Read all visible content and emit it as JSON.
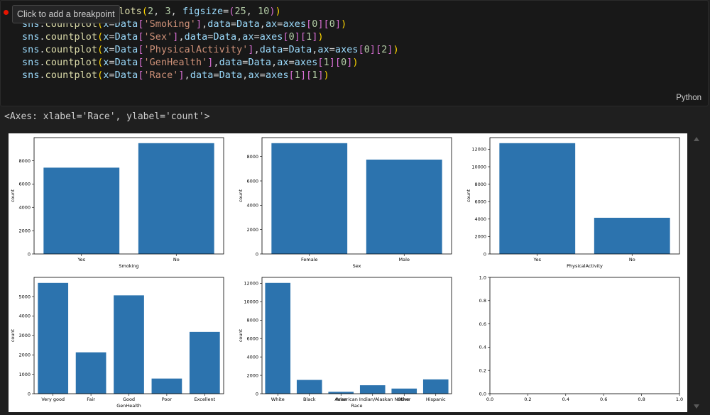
{
  "editor": {
    "tooltip": "Click to add a breakpoint",
    "language": "Python",
    "code_lines": [
      [
        {
          "t": "plots",
          "c": "tok-fn"
        },
        {
          "t": "(",
          "c": "tok-br"
        },
        {
          "t": "2",
          "c": "tok-num"
        },
        {
          "t": ", ",
          "c": "tok-op"
        },
        {
          "t": "3",
          "c": "tok-num"
        },
        {
          "t": ", ",
          "c": "tok-op"
        },
        {
          "t": "figsize",
          "c": "tok-var"
        },
        {
          "t": "=",
          "c": "tok-op"
        },
        {
          "t": "(",
          "c": "tok-br2"
        },
        {
          "t": "25",
          "c": "tok-num"
        },
        {
          "t": ", ",
          "c": "tok-op"
        },
        {
          "t": "10",
          "c": "tok-num"
        },
        {
          "t": ")",
          "c": "tok-br2"
        },
        {
          "t": ")",
          "c": "tok-br"
        }
      ],
      [
        {
          "t": "sns",
          "c": "tok-var"
        },
        {
          "t": ".",
          "c": "tok-op"
        },
        {
          "t": "countplot",
          "c": "tok-fn"
        },
        {
          "t": "(",
          "c": "tok-br"
        },
        {
          "t": "x",
          "c": "tok-var"
        },
        {
          "t": "=",
          "c": "tok-op"
        },
        {
          "t": "Data",
          "c": "tok-var"
        },
        {
          "t": "[",
          "c": "tok-br2"
        },
        {
          "t": "'Smoking'",
          "c": "tok-str"
        },
        {
          "t": "]",
          "c": "tok-br2"
        },
        {
          "t": ",",
          "c": "tok-op"
        },
        {
          "t": "data",
          "c": "tok-var"
        },
        {
          "t": "=",
          "c": "tok-op"
        },
        {
          "t": "Data",
          "c": "tok-var"
        },
        {
          "t": ",",
          "c": "tok-op"
        },
        {
          "t": "ax",
          "c": "tok-var"
        },
        {
          "t": "=",
          "c": "tok-op"
        },
        {
          "t": "axes",
          "c": "tok-var"
        },
        {
          "t": "[",
          "c": "tok-br2"
        },
        {
          "t": "0",
          "c": "tok-num"
        },
        {
          "t": "]",
          "c": "tok-br2"
        },
        {
          "t": "[",
          "c": "tok-br2"
        },
        {
          "t": "0",
          "c": "tok-num"
        },
        {
          "t": "]",
          "c": "tok-br2"
        },
        {
          "t": ")",
          "c": "tok-br"
        }
      ],
      [
        {
          "t": "sns",
          "c": "tok-var"
        },
        {
          "t": ".",
          "c": "tok-op"
        },
        {
          "t": "countplot",
          "c": "tok-fn"
        },
        {
          "t": "(",
          "c": "tok-br"
        },
        {
          "t": "x",
          "c": "tok-var"
        },
        {
          "t": "=",
          "c": "tok-op"
        },
        {
          "t": "Data",
          "c": "tok-var"
        },
        {
          "t": "[",
          "c": "tok-br2"
        },
        {
          "t": "'Sex'",
          "c": "tok-str"
        },
        {
          "t": "]",
          "c": "tok-br2"
        },
        {
          "t": ",",
          "c": "tok-op"
        },
        {
          "t": "data",
          "c": "tok-var"
        },
        {
          "t": "=",
          "c": "tok-op"
        },
        {
          "t": "Data",
          "c": "tok-var"
        },
        {
          "t": ",",
          "c": "tok-op"
        },
        {
          "t": "ax",
          "c": "tok-var"
        },
        {
          "t": "=",
          "c": "tok-op"
        },
        {
          "t": "axes",
          "c": "tok-var"
        },
        {
          "t": "[",
          "c": "tok-br2"
        },
        {
          "t": "0",
          "c": "tok-num"
        },
        {
          "t": "]",
          "c": "tok-br2"
        },
        {
          "t": "[",
          "c": "tok-br2"
        },
        {
          "t": "1",
          "c": "tok-num"
        },
        {
          "t": "]",
          "c": "tok-br2"
        },
        {
          "t": ")",
          "c": "tok-br"
        }
      ],
      [
        {
          "t": "sns",
          "c": "tok-var"
        },
        {
          "t": ".",
          "c": "tok-op"
        },
        {
          "t": "countplot",
          "c": "tok-fn"
        },
        {
          "t": "(",
          "c": "tok-br"
        },
        {
          "t": "x",
          "c": "tok-var"
        },
        {
          "t": "=",
          "c": "tok-op"
        },
        {
          "t": "Data",
          "c": "tok-var"
        },
        {
          "t": "[",
          "c": "tok-br2"
        },
        {
          "t": "'PhysicalActivity'",
          "c": "tok-str"
        },
        {
          "t": "]",
          "c": "tok-br2"
        },
        {
          "t": ",",
          "c": "tok-op"
        },
        {
          "t": "data",
          "c": "tok-var"
        },
        {
          "t": "=",
          "c": "tok-op"
        },
        {
          "t": "Data",
          "c": "tok-var"
        },
        {
          "t": ",",
          "c": "tok-op"
        },
        {
          "t": "ax",
          "c": "tok-var"
        },
        {
          "t": "=",
          "c": "tok-op"
        },
        {
          "t": "axes",
          "c": "tok-var"
        },
        {
          "t": "[",
          "c": "tok-br2"
        },
        {
          "t": "0",
          "c": "tok-num"
        },
        {
          "t": "]",
          "c": "tok-br2"
        },
        {
          "t": "[",
          "c": "tok-br2"
        },
        {
          "t": "2",
          "c": "tok-num"
        },
        {
          "t": "]",
          "c": "tok-br2"
        },
        {
          "t": ")",
          "c": "tok-br"
        }
      ],
      [
        {
          "t": "sns",
          "c": "tok-var"
        },
        {
          "t": ".",
          "c": "tok-op"
        },
        {
          "t": "countplot",
          "c": "tok-fn"
        },
        {
          "t": "(",
          "c": "tok-br"
        },
        {
          "t": "x",
          "c": "tok-var"
        },
        {
          "t": "=",
          "c": "tok-op"
        },
        {
          "t": "Data",
          "c": "tok-var"
        },
        {
          "t": "[",
          "c": "tok-br2"
        },
        {
          "t": "'GenHealth'",
          "c": "tok-str"
        },
        {
          "t": "]",
          "c": "tok-br2"
        },
        {
          "t": ",",
          "c": "tok-op"
        },
        {
          "t": "data",
          "c": "tok-var"
        },
        {
          "t": "=",
          "c": "tok-op"
        },
        {
          "t": "Data",
          "c": "tok-var"
        },
        {
          "t": ",",
          "c": "tok-op"
        },
        {
          "t": "ax",
          "c": "tok-var"
        },
        {
          "t": "=",
          "c": "tok-op"
        },
        {
          "t": "axes",
          "c": "tok-var"
        },
        {
          "t": "[",
          "c": "tok-br2"
        },
        {
          "t": "1",
          "c": "tok-num"
        },
        {
          "t": "]",
          "c": "tok-br2"
        },
        {
          "t": "[",
          "c": "tok-br2"
        },
        {
          "t": "0",
          "c": "tok-num"
        },
        {
          "t": "]",
          "c": "tok-br2"
        },
        {
          "t": ")",
          "c": "tok-br"
        }
      ],
      [
        {
          "t": "sns",
          "c": "tok-var"
        },
        {
          "t": ".",
          "c": "tok-op"
        },
        {
          "t": "countplot",
          "c": "tok-fn"
        },
        {
          "t": "(",
          "c": "tok-br"
        },
        {
          "t": "x",
          "c": "tok-var"
        },
        {
          "t": "=",
          "c": "tok-op"
        },
        {
          "t": "Data",
          "c": "tok-var"
        },
        {
          "t": "[",
          "c": "tok-br2"
        },
        {
          "t": "'Race'",
          "c": "tok-str"
        },
        {
          "t": "]",
          "c": "tok-br2"
        },
        {
          "t": ",",
          "c": "tok-op"
        },
        {
          "t": "data",
          "c": "tok-var"
        },
        {
          "t": "=",
          "c": "tok-op"
        },
        {
          "t": "Data",
          "c": "tok-var"
        },
        {
          "t": ",",
          "c": "tok-op"
        },
        {
          "t": "ax",
          "c": "tok-var"
        },
        {
          "t": "=",
          "c": "tok-op"
        },
        {
          "t": "axes",
          "c": "tok-var"
        },
        {
          "t": "[",
          "c": "tok-br2"
        },
        {
          "t": "1",
          "c": "tok-num"
        },
        {
          "t": "]",
          "c": "tok-br2"
        },
        {
          "t": "[",
          "c": "tok-br2"
        },
        {
          "t": "1",
          "c": "tok-num"
        },
        {
          "t": "]",
          "c": "tok-br2"
        },
        {
          "t": ")",
          "c": "tok-br"
        }
      ]
    ]
  },
  "output": {
    "repr": "<Axes: xlabel='Race', ylabel='count'>"
  },
  "chart_data": [
    {
      "type": "bar",
      "categories": [
        "Yes",
        "No"
      ],
      "values": [
        7400,
        9500
      ],
      "xlabel": "Smoking",
      "ylabel": "count",
      "ylim": [
        0,
        9975
      ],
      "yticks": [
        0,
        2000,
        4000,
        6000,
        8000
      ],
      "color": "#2c73ae"
    },
    {
      "type": "bar",
      "categories": [
        "Female",
        "Male"
      ],
      "values": [
        9100,
        7750
      ],
      "xlabel": "Sex",
      "ylabel": "count",
      "ylim": [
        0,
        9555
      ],
      "yticks": [
        0,
        2000,
        4000,
        6000,
        8000
      ],
      "color": "#2c73ae"
    },
    {
      "type": "bar",
      "categories": [
        "Yes",
        "No"
      ],
      "values": [
        12700,
        4150
      ],
      "xlabel": "PhysicalActivity",
      "ylabel": "count",
      "ylim": [
        0,
        13335
      ],
      "yticks": [
        0,
        2000,
        4000,
        6000,
        8000,
        10000,
        12000
      ],
      "color": "#2c73ae"
    },
    {
      "type": "bar",
      "categories": [
        "Very good",
        "Fair",
        "Good",
        "Poor",
        "Excellent"
      ],
      "values": [
        5700,
        2130,
        5060,
        780,
        3180
      ],
      "xlabel": "GenHealth",
      "ylabel": "count",
      "ylim": [
        0,
        5985
      ],
      "yticks": [
        0,
        1000,
        2000,
        3000,
        4000,
        5000
      ],
      "color": "#2c73ae"
    },
    {
      "type": "bar",
      "categories": [
        "White",
        "Black",
        "Asian",
        "American Indian/Alaskan Native",
        "Other",
        "Hispanic"
      ],
      "values": [
        12050,
        1500,
        210,
        920,
        560,
        1560
      ],
      "xlabel": "Race",
      "ylabel": "count",
      "ylim": [
        0,
        12650
      ],
      "yticks": [
        0,
        2000,
        4000,
        6000,
        8000,
        10000,
        12000
      ],
      "color": "#2c73ae"
    },
    {
      "type": "empty",
      "xlim": [
        0,
        1
      ],
      "ylim": [
        0,
        1
      ],
      "xticks": [
        "0.0",
        "0.2",
        "0.4",
        "0.6",
        "0.8",
        "1.0"
      ],
      "yticks": [
        "0.0",
        "0.2",
        "0.4",
        "0.6",
        "0.8",
        "1.0"
      ]
    }
  ]
}
